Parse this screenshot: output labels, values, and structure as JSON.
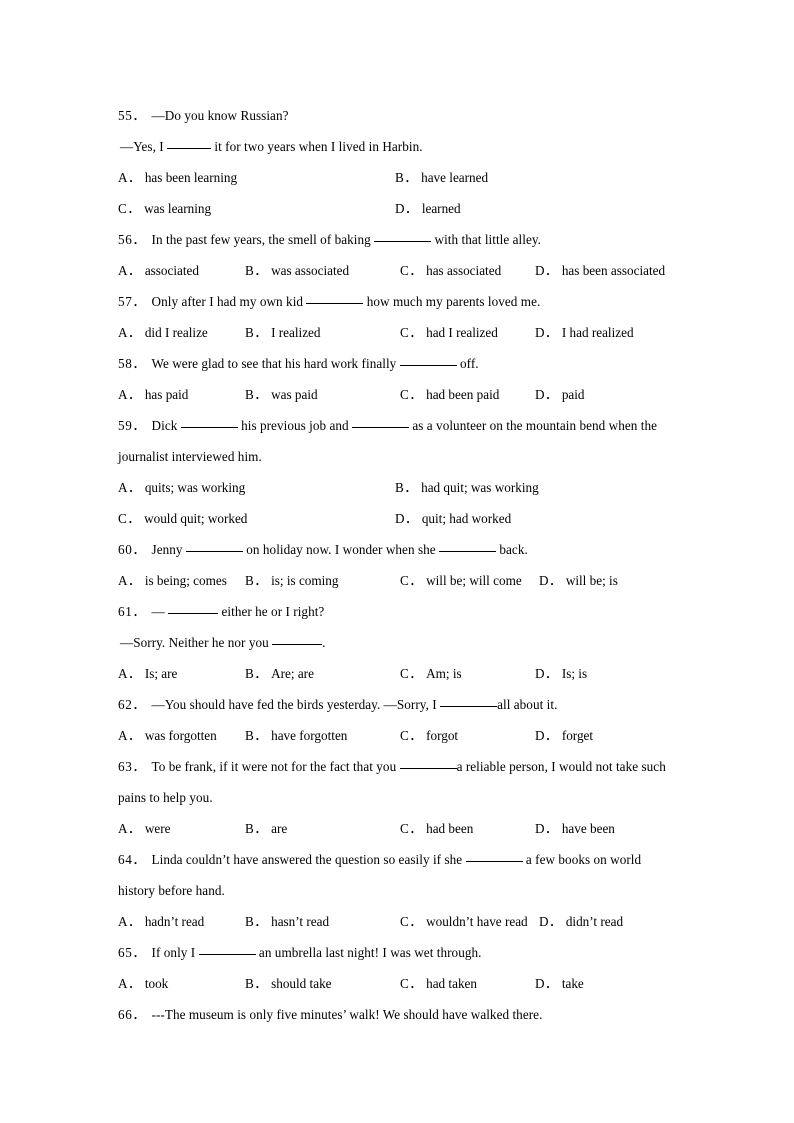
{
  "document": {
    "type": "english-grammar-worksheet",
    "page_background": "#ffffff",
    "text_color": "#000000"
  },
  "questions": [
    {
      "number": "55．",
      "layout": "half",
      "stem_lines": [
        {
          "segments": [
            {
              "kind": "text",
              "value": "—Do you know Russian?"
            }
          ]
        },
        {
          "segments": [
            {
              "kind": "text",
              "value": "—Yes, I "
            },
            {
              "kind": "blank",
              "width": "b5"
            },
            {
              "kind": "text",
              "value": " it for two years when I lived in Harbin."
            }
          ]
        }
      ],
      "options": [
        {
          "label": "A．",
          "text": "has been learning"
        },
        {
          "label": "B．",
          "text": "have learned"
        },
        {
          "label": "C．",
          "text": "was learning"
        },
        {
          "label": "D．",
          "text": "learned"
        }
      ]
    },
    {
      "number": "56．",
      "layout": "quarter",
      "stem_lines": [
        {
          "segments": [
            {
              "kind": "text",
              "value": "In the past few years, the smell of baking "
            },
            {
              "kind": "blank",
              "width": "b7"
            },
            {
              "kind": "text",
              "value": " with that little alley."
            }
          ]
        }
      ],
      "options": [
        {
          "label": "A．",
          "text": "associated"
        },
        {
          "label": "B．",
          "text": "was associated"
        },
        {
          "label": "C．",
          "text": "has associated"
        },
        {
          "label": "D．",
          "text": "has been associated"
        }
      ]
    },
    {
      "number": "57．",
      "layout": "quarter",
      "stem_lines": [
        {
          "segments": [
            {
              "kind": "text",
              "value": "Only after I had my own kid "
            },
            {
              "kind": "blank",
              "width": "b7"
            },
            {
              "kind": "text",
              "value": " how much my parents loved me."
            }
          ]
        }
      ],
      "options": [
        {
          "label": "A．",
          "text": "did I realize"
        },
        {
          "label": "B．",
          "text": "I realized"
        },
        {
          "label": "C．",
          "text": "had I realized"
        },
        {
          "label": "D．",
          "text": "I had realized"
        }
      ]
    },
    {
      "number": "58．",
      "layout": "quarter",
      "stem_lines": [
        {
          "segments": [
            {
              "kind": "text",
              "value": "We were glad to see that his hard work finally "
            },
            {
              "kind": "blank",
              "width": "b7"
            },
            {
              "kind": "text",
              "value": " off."
            }
          ]
        }
      ],
      "options": [
        {
          "label": "A．",
          "text": "has paid"
        },
        {
          "label": "B．",
          "text": "was paid"
        },
        {
          "label": "C．",
          "text": "had been paid"
        },
        {
          "label": "D．",
          "text": "paid"
        }
      ]
    },
    {
      "number": "59．",
      "layout": "half",
      "stem_lines": [
        {
          "wrap": true,
          "segments": [
            {
              "kind": "text",
              "value": "Dick "
            },
            {
              "kind": "blank",
              "width": "b7"
            },
            {
              "kind": "text",
              "value": " his previous job and "
            },
            {
              "kind": "blank",
              "width": "b7"
            },
            {
              "kind": "text",
              "value": " as a volunteer on the mountain bend when the journalist interviewed him."
            }
          ]
        }
      ],
      "options": [
        {
          "label": "A．",
          "text": "quits; was working"
        },
        {
          "label": "B．",
          "text": "had quit; was working"
        },
        {
          "label": "C．",
          "text": "would quit; worked"
        },
        {
          "label": "D．",
          "text": "quit; had worked"
        }
      ]
    },
    {
      "number": "60．",
      "layout": "flow",
      "stem_lines": [
        {
          "segments": [
            {
              "kind": "text",
              "value": "Jenny "
            },
            {
              "kind": "blank",
              "width": "b7"
            },
            {
              "kind": "text",
              "value": " on holiday now. I wonder when she "
            },
            {
              "kind": "blank",
              "width": "b7"
            },
            {
              "kind": "text",
              "value": " back."
            }
          ]
        }
      ],
      "options": [
        {
          "label": "A．",
          "text": "is being; comes"
        },
        {
          "label": "B．",
          "text": "is; is coming"
        },
        {
          "label": "C．",
          "text": "will be; will come"
        },
        {
          "label": "D．",
          "text": "will be; is"
        }
      ]
    },
    {
      "number": "61．",
      "layout": "quarter",
      "stem_lines": [
        {
          "segments": [
            {
              "kind": "text",
              "value": "— "
            },
            {
              "kind": "blank",
              "width": "b6"
            },
            {
              "kind": "text",
              "value": " either he or I right?"
            }
          ]
        },
        {
          "segments": [
            {
              "kind": "text",
              "value": "—Sorry. Neither he nor you "
            },
            {
              "kind": "blank",
              "width": "b6"
            },
            {
              "kind": "text",
              "value": "."
            }
          ]
        }
      ],
      "options": [
        {
          "label": "A．",
          "text": "Is; are"
        },
        {
          "label": "B．",
          "text": "Are; are"
        },
        {
          "label": "C．",
          "text": "Am; is"
        },
        {
          "label": "D．",
          "text": "Is; is"
        }
      ]
    },
    {
      "number": "62．",
      "layout": "quarter",
      "stem_lines": [
        {
          "segments": [
            {
              "kind": "text",
              "value": "—You should have fed the birds yesterday. —Sorry, I "
            },
            {
              "kind": "blank",
              "width": "b7"
            },
            {
              "kind": "text",
              "value": "all about it."
            }
          ]
        }
      ],
      "options": [
        {
          "label": "A．",
          "text": "was forgotten"
        },
        {
          "label": "B．",
          "text": "have forgotten"
        },
        {
          "label": "C．",
          "text": "forgot"
        },
        {
          "label": "D．",
          "text": "forget"
        }
      ]
    },
    {
      "number": "63．",
      "layout": "quarter",
      "stem_lines": [
        {
          "wrap": true,
          "segments": [
            {
              "kind": "text",
              "value": "To be frank, if it were not for the fact that you "
            },
            {
              "kind": "blank",
              "width": "b7"
            },
            {
              "kind": "text",
              "value": "a reliable person, I would not take such pains to help you."
            }
          ]
        }
      ],
      "options": [
        {
          "label": "A．",
          "text": "were"
        },
        {
          "label": "B．",
          "text": "are"
        },
        {
          "label": "C．",
          "text": "had been"
        },
        {
          "label": "D．",
          "text": "have been"
        }
      ]
    },
    {
      "number": "64．",
      "layout": "flow",
      "stem_lines": [
        {
          "wrap": true,
          "segments": [
            {
              "kind": "text",
              "value": "Linda couldn’t have answered the question so easily if she "
            },
            {
              "kind": "blank",
              "width": "b7"
            },
            {
              "kind": "text",
              "value": " a few books on world history before hand."
            }
          ]
        }
      ],
      "options": [
        {
          "label": "A．",
          "text": "hadn’t read"
        },
        {
          "label": "B．",
          "text": "hasn’t read"
        },
        {
          "label": "C．",
          "text": "wouldn’t have read"
        },
        {
          "label": "D．",
          "text": "didn’t read"
        }
      ]
    },
    {
      "number": "65．",
      "layout": "quarter",
      "stem_lines": [
        {
          "segments": [
            {
              "kind": "text",
              "value": "If only I "
            },
            {
              "kind": "blank",
              "width": "b7"
            },
            {
              "kind": "text",
              "value": " an umbrella last night! I was wet through."
            }
          ]
        }
      ],
      "options": [
        {
          "label": "A．",
          "text": "took"
        },
        {
          "label": "B．",
          "text": "should take"
        },
        {
          "label": "C．",
          "text": "had taken"
        },
        {
          "label": "D．",
          "text": "take"
        }
      ]
    },
    {
      "number": "66．",
      "layout": "none",
      "stem_lines": [
        {
          "segments": [
            {
              "kind": "text",
              "value": "---The museum is only five minutes’ walk! We should have walked there."
            }
          ]
        }
      ],
      "options": []
    }
  ]
}
